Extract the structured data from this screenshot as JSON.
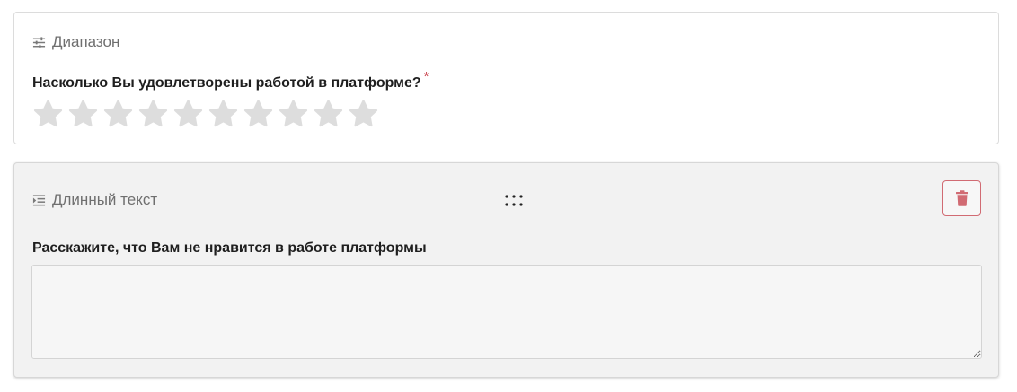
{
  "questions": [
    {
      "type_label": "Диапазон",
      "type_icon": "sliders-icon",
      "text": "Насколько Вы удовлетворены работой в платформе?",
      "required_mark": "*",
      "rating": {
        "max": 10,
        "value": 0,
        "star_icon": "star-icon",
        "star_color": "#dddddd"
      }
    },
    {
      "type_label": "Длинный текст",
      "type_icon": "text-indent-icon",
      "text": "Расскажите, что Вам не нравится в работе платформы",
      "answer_value": "",
      "drag_icon": "drag-handle-icon",
      "delete_icon": "trash-icon",
      "delete_color": "#d16b73"
    }
  ]
}
